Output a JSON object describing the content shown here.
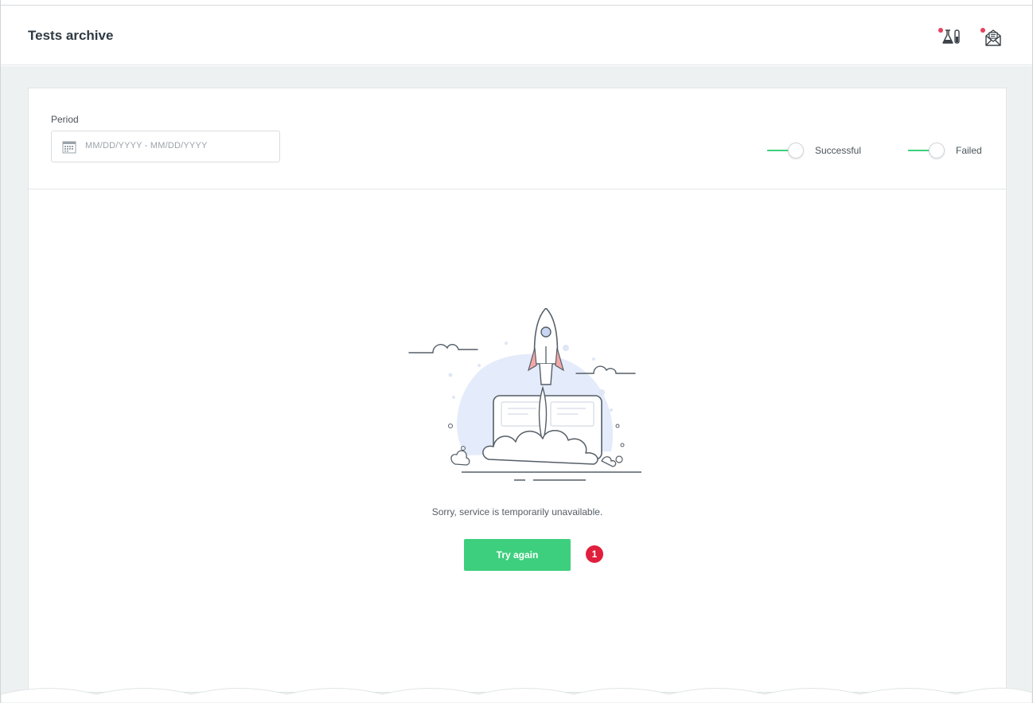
{
  "header": {
    "title": "Tests archive",
    "icons": [
      "tests-flask-icon",
      "mail-icon"
    ]
  },
  "filters": {
    "period_label": "Period",
    "date_placeholder": "MM/DD/YYYY - MM/DD/YYYY",
    "toggles": [
      {
        "label": "Successful",
        "on": true
      },
      {
        "label": "Failed",
        "on": true
      }
    ]
  },
  "empty_state": {
    "illustration": "rocket-launch-laptop-illustration",
    "message": "Sorry, service is temporarily unavailable.",
    "button_label": "Try again",
    "step_badge": "1"
  },
  "colors": {
    "accent": "#3ecf7e",
    "badge": "#e01f3d",
    "notification_dot": "#e8405c",
    "background": "#eef1f1"
  }
}
